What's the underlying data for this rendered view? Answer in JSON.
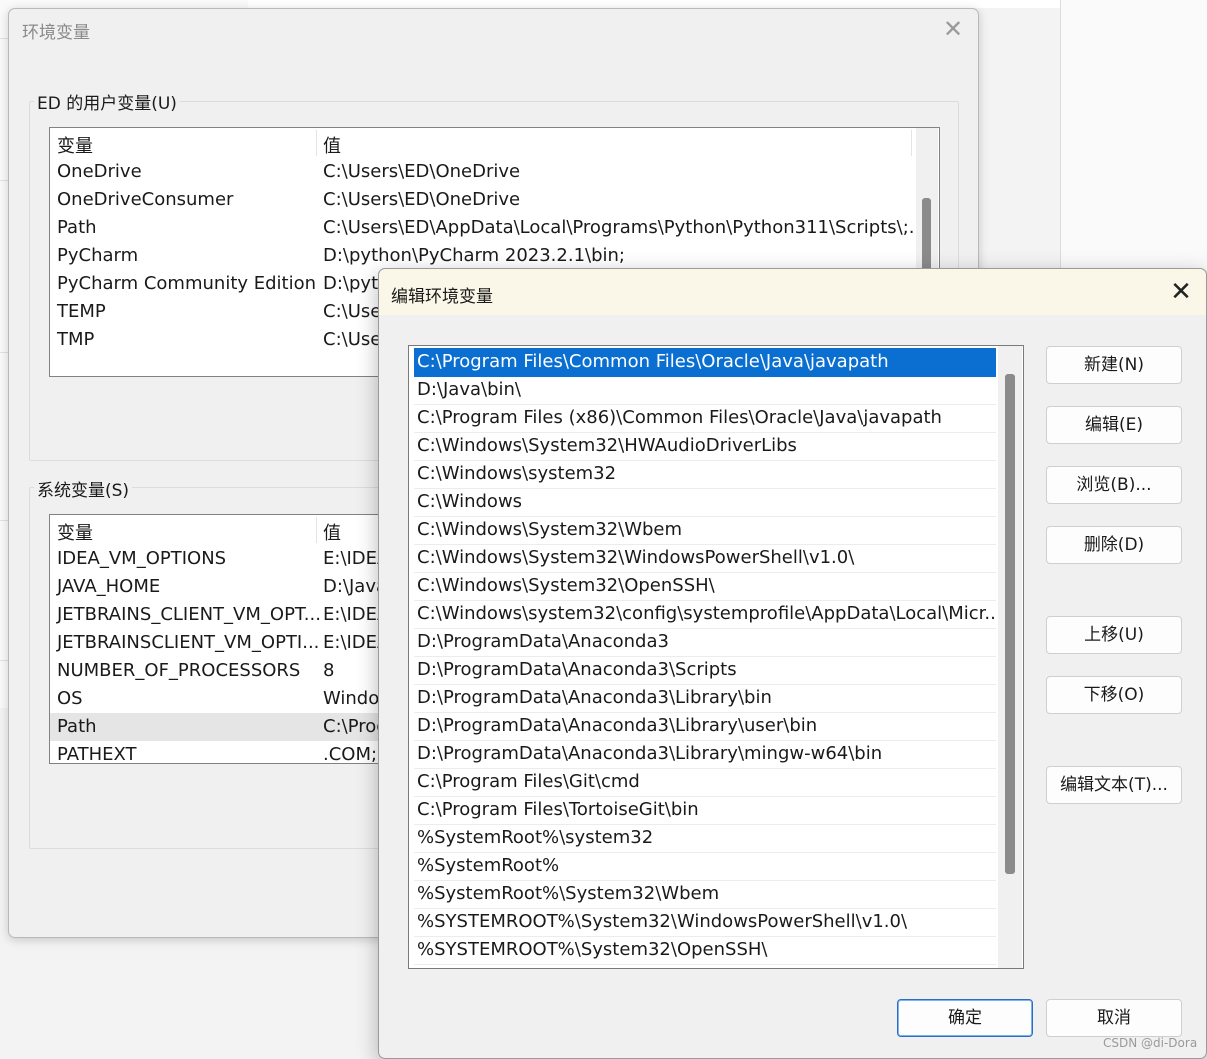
{
  "env_dialog": {
    "title": "环境变量",
    "user_group_label": "ED 的用户变量(U)",
    "system_group_label": "系统变量(S)",
    "col_var": "变量",
    "col_value": "值",
    "user_vars": [
      {
        "name": "OneDrive",
        "value": "C:\\Users\\ED\\OneDrive"
      },
      {
        "name": "OneDriveConsumer",
        "value": "C:\\Users\\ED\\OneDrive"
      },
      {
        "name": "Path",
        "value": "C:\\Users\\ED\\AppData\\Local\\Programs\\Python\\Python311\\Scripts\\;..."
      },
      {
        "name": "PyCharm",
        "value": "D:\\python\\PyCharm 2023.2.1\\bin;"
      },
      {
        "name": "PyCharm Community Edition",
        "value": "D:\\pytl"
      },
      {
        "name": "TEMP",
        "value": "C:\\User"
      },
      {
        "name": "TMP",
        "value": "C:\\User"
      }
    ],
    "system_vars": [
      {
        "name": "IDEA_VM_OPTIONS",
        "value": "E:\\IDEA"
      },
      {
        "name": "JAVA_HOME",
        "value": "D:\\Java"
      },
      {
        "name": "JETBRAINS_CLIENT_VM_OPT...",
        "value": "E:\\IDEA"
      },
      {
        "name": "JETBRAINSCLIENT_VM_OPTI...",
        "value": "E:\\IDEA"
      },
      {
        "name": "NUMBER_OF_PROCESSORS",
        "value": "8"
      },
      {
        "name": "OS",
        "value": "Windo"
      },
      {
        "name": "Path",
        "value": "C:\\Prog"
      },
      {
        "name": "PATHEXT",
        "value": ".COM;"
      }
    ],
    "system_selected_index": 6
  },
  "edit_dialog": {
    "title": "编辑环境变量",
    "selected_index": 0,
    "paths": [
      "C:\\Program Files\\Common Files\\Oracle\\Java\\javapath",
      "D:\\Java\\bin\\",
      "C:\\Program Files (x86)\\Common Files\\Oracle\\Java\\javapath",
      "C:\\Windows\\System32\\HWAudioDriverLibs",
      "C:\\Windows\\system32",
      "C:\\Windows",
      "C:\\Windows\\System32\\Wbem",
      "C:\\Windows\\System32\\WindowsPowerShell\\v1.0\\",
      "C:\\Windows\\System32\\OpenSSH\\",
      "C:\\Windows\\system32\\config\\systemprofile\\AppData\\Local\\Micr...",
      "D:\\ProgramData\\Anaconda3",
      "D:\\ProgramData\\Anaconda3\\Scripts",
      "D:\\ProgramData\\Anaconda3\\Library\\bin",
      "D:\\ProgramData\\Anaconda3\\Library\\user\\bin",
      "D:\\ProgramData\\Anaconda3\\Library\\mingw-w64\\bin",
      "C:\\Program Files\\Git\\cmd",
      "C:\\Program Files\\TortoiseGit\\bin",
      "%SystemRoot%\\system32",
      "%SystemRoot%",
      "%SystemRoot%\\System32\\Wbem",
      "%SYSTEMROOT%\\System32\\WindowsPowerShell\\v1.0\\",
      "%SYSTEMROOT%\\System32\\OpenSSH\\"
    ],
    "buttons": {
      "new": "新建(N)",
      "edit": "编辑(E)",
      "browse": "浏览(B)...",
      "delete": "删除(D)",
      "move_up": "上移(U)",
      "move_down": "下移(O)",
      "edit_text": "编辑文本(T)...",
      "ok": "确定",
      "cancel": "取消"
    }
  },
  "watermark": "CSDN @di-Dora",
  "colors": {
    "selection": "#0a6fd0",
    "dialog_bg": "#f0f0f0",
    "title_bar": "#faf6e8"
  }
}
